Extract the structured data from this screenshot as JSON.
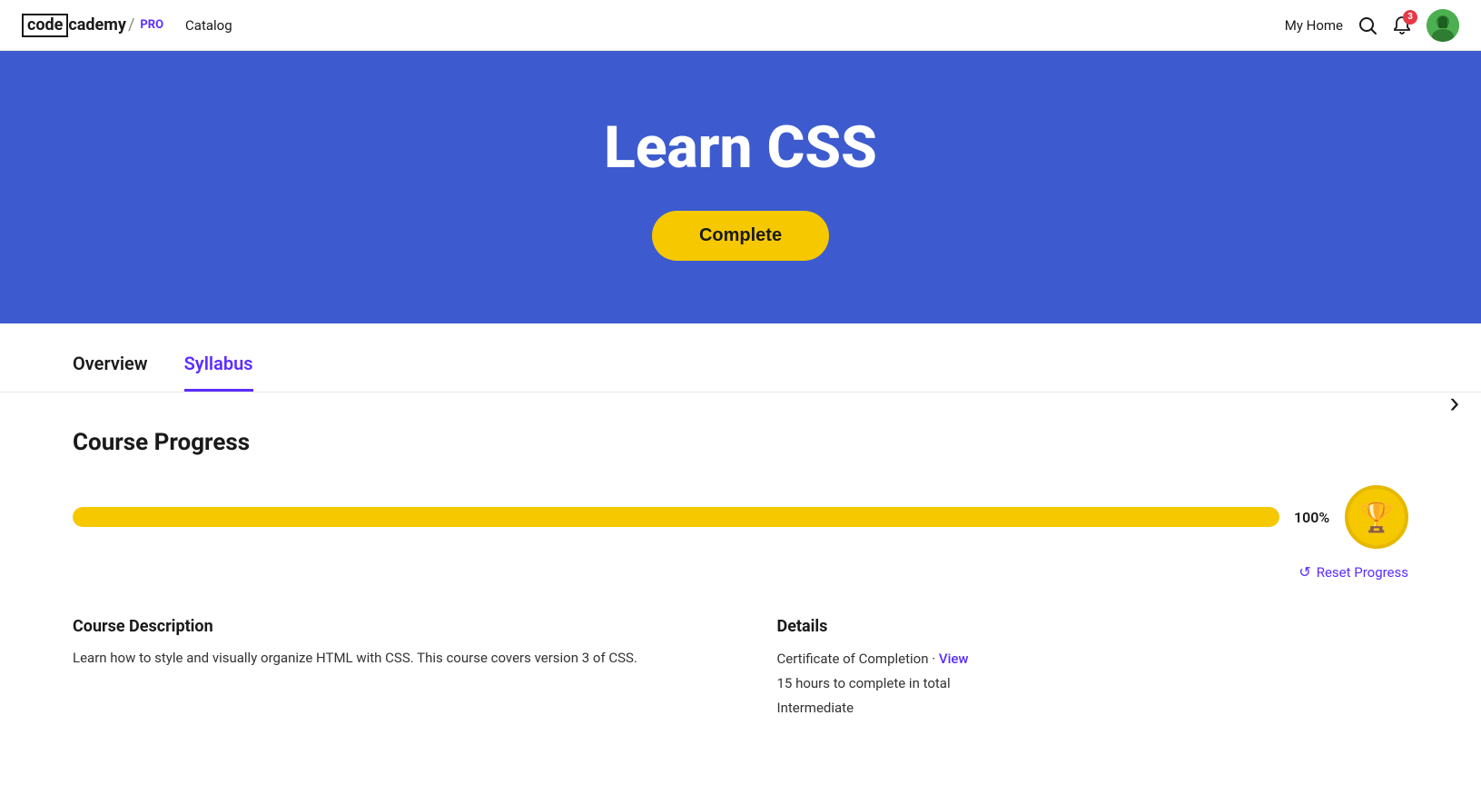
{
  "navbar": {
    "logo": {
      "code_text": "code",
      "academy_text": "cademy",
      "slash": "/",
      "pro_text": "PRO"
    },
    "catalog_label": "Catalog",
    "my_home_label": "My Home",
    "notification_count": "3"
  },
  "hero": {
    "title": "Learn CSS",
    "complete_button": "Complete"
  },
  "tabs": [
    {
      "label": "Overview",
      "active": false
    },
    {
      "label": "Syllabus",
      "active": true
    }
  ],
  "course_progress": {
    "section_title": "Course Progress",
    "progress_percent": 100,
    "progress_label": "100%",
    "reset_label": "Reset Progress"
  },
  "course_description": {
    "label": "Course Description",
    "text": "Learn how to style and visually organize HTML with CSS. This course covers version 3 of CSS."
  },
  "details": {
    "label": "Details",
    "certificate_text": "Certificate of Completion",
    "certificate_separator": " · ",
    "certificate_link": "View",
    "hours_text": "15 hours to complete in total",
    "level_text": "Intermediate"
  },
  "chevron": {
    "symbol": "›"
  }
}
